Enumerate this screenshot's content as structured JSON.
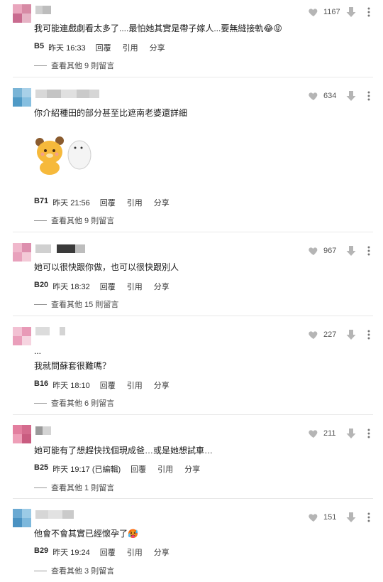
{
  "reply_label": "回覆",
  "quote_label": "引用",
  "share_label": "分享",
  "comments": [
    {
      "text": "我可能連戲劇看太多了....最怕她其實是帶子嫁人...要無縫接軌",
      "emoji": "😂😝",
      "floor": "B5",
      "time": "昨天 16:33",
      "likes": "1167",
      "replies": "查看其他 9 則留言"
    },
    {
      "text": "你介紹種田的部分甚至比遮南老婆還詳細",
      "floor": "B71",
      "time": "昨天 21:56",
      "likes": "634",
      "replies": "查看其他 9 則留言"
    },
    {
      "text": "她可以很快跟你做，也可以很快跟別人",
      "floor": "B20",
      "time": "昨天 18:32",
      "likes": "967",
      "replies": "查看其他 15 則留言"
    },
    {
      "text_pre": "...",
      "text": "我就問蘇套很難嗎？",
      "floor": "B16",
      "time": "昨天 18:10",
      "likes": "227",
      "replies": "查看其他 6 則留言"
    },
    {
      "text": "她可能有了想趕快找個現成爸…或是她想試車…",
      "floor": "B25",
      "time": "昨天 19:17 (已編輯)",
      "likes": "211",
      "replies": "查看其他 1 則留言"
    },
    {
      "text": "他會不會其實已經懷孕了",
      "emoji": "🥵",
      "floor": "B29",
      "time": "昨天 19:24",
      "likes": "151",
      "replies": "查看其他 3 則留言"
    }
  ]
}
